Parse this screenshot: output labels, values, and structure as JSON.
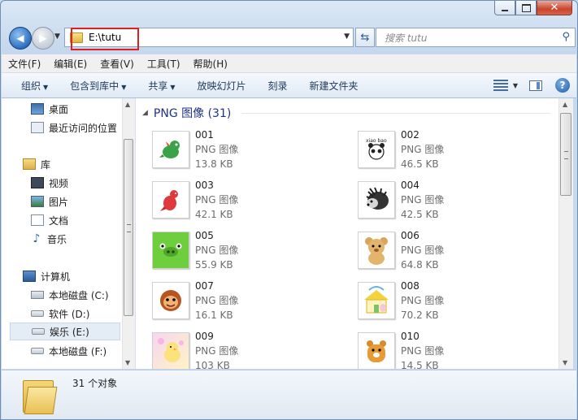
{
  "window": {
    "caption": {
      "minimize_icon": "minimize-icon",
      "maximize_icon": "maximize-icon",
      "close_icon": "close-icon"
    }
  },
  "address_bar": {
    "path": "E:\\tutu",
    "search_placeholder": "搜索 tutu"
  },
  "menu": [
    "文件(F)",
    "编辑(E)",
    "查看(V)",
    "工具(T)",
    "帮助(H)"
  ],
  "command_bar": {
    "organize": "组织",
    "include_in_library": "包含到库中",
    "share": "共享",
    "slideshow": "放映幻灯片",
    "burn": "刻录",
    "new_folder": "新建文件夹"
  },
  "nav_pane": {
    "favorites": [
      "桌面",
      "最近访问的位置"
    ],
    "library_title": "库",
    "libraries": [
      "视频",
      "图片",
      "文档",
      "音乐"
    ],
    "computer_title": "计算机",
    "drives": [
      "本地磁盘 (C:)",
      "软件 (D:)",
      "娱乐 (E:)",
      "本地磁盘 (F:)"
    ],
    "selected_drive": "娱乐 (E:)"
  },
  "content": {
    "group_header": "PNG 图像 (31)",
    "items": [
      {
        "name": "001",
        "type": "PNG 图像",
        "size": "13.8 KB",
        "thumb": "green-dragon"
      },
      {
        "name": "002",
        "type": "PNG 图像",
        "size": "46.5 KB",
        "thumb": "panda-logo"
      },
      {
        "name": "003",
        "type": "PNG 图像",
        "size": "42.1 KB",
        "thumb": "red-dino"
      },
      {
        "name": "004",
        "type": "PNG 图像",
        "size": "42.5 KB",
        "thumb": "hedgehog"
      },
      {
        "name": "005",
        "type": "PNG 图像",
        "size": "55.9 KB",
        "thumb": "green-pig"
      },
      {
        "name": "006",
        "type": "PNG 图像",
        "size": "64.8 KB",
        "thumb": "teddy-bear"
      },
      {
        "name": "007",
        "type": "PNG 图像",
        "size": "16.1 KB",
        "thumb": "monkey"
      },
      {
        "name": "008",
        "type": "PNG 图像",
        "size": "70.2 KB",
        "thumb": "bunny-house"
      },
      {
        "name": "009",
        "type": "PNG 图像",
        "size": "103 KB",
        "thumb": "yellow-chick"
      },
      {
        "name": "010",
        "type": "PNG 图像",
        "size": "14.5 KB",
        "thumb": "orange-hamster"
      }
    ]
  },
  "details": {
    "count_text": "31 个对象"
  }
}
